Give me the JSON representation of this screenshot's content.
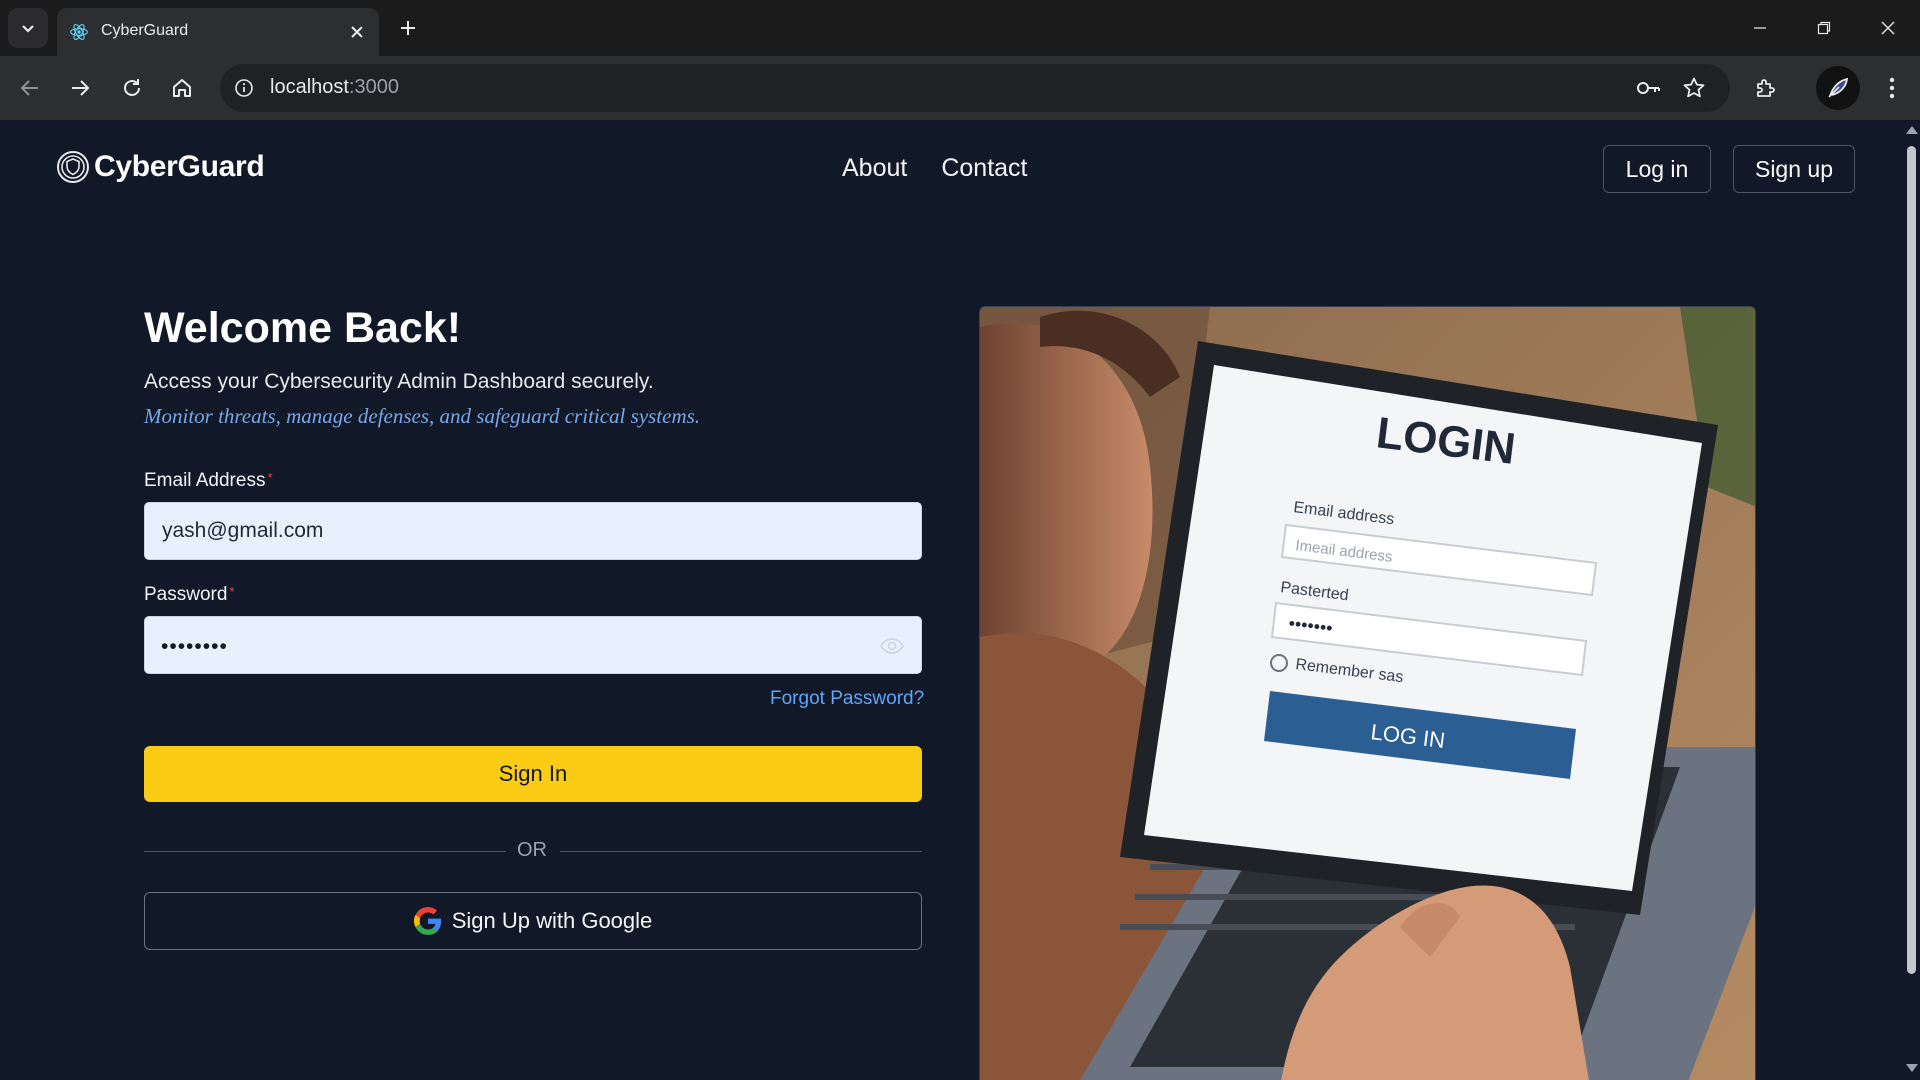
{
  "browser": {
    "tab_title": "CyberGuard",
    "url_host": "localhost",
    "url_port": ":3000"
  },
  "header": {
    "brand": "CyberGuard",
    "nav": [
      "About",
      "Contact"
    ],
    "login": "Log in",
    "signup": "Sign up"
  },
  "form": {
    "title": "Welcome Back!",
    "subtitle": "Access your Cybersecurity Admin Dashboard securely.",
    "tagline": "Monitor threats, manage defenses, and safeguard critical systems.",
    "email_label": "Email Address",
    "email_value": "yash@gmail.com",
    "password_label": "Password",
    "password_value": "••••••••",
    "required_mark": "*",
    "forgot": "Forgot Password?",
    "signin": "Sign In",
    "or": "OR",
    "google": "Sign Up with Google"
  },
  "illustration": {
    "screen_title": "LOGIN",
    "email_label": "Email address",
    "email_placeholder": "Imeail address",
    "password_label": "Pasterted",
    "password_dots": "•••••••",
    "remember": "Remember sas",
    "button": "LOG IN"
  },
  "colors": {
    "page_bg": "#111827",
    "accent_button": "#facc15",
    "link": "#60a5fa",
    "tagline": "#7aa7e8",
    "required": "#ef4444"
  }
}
